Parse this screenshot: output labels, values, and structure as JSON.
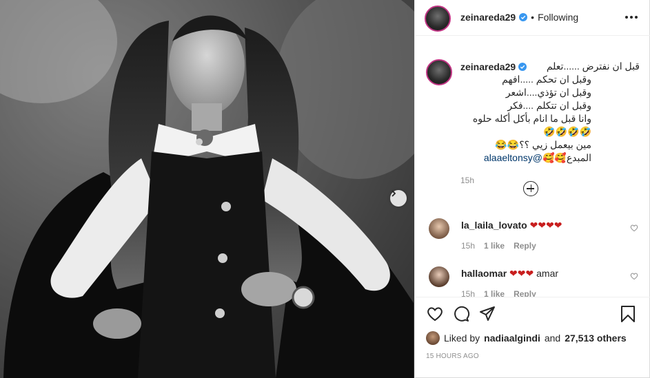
{
  "post": {
    "photo_alt": "Black and white photo of woman in cape and vest",
    "has_next": true
  },
  "header": {
    "username": "zeinareda29",
    "separator": "•",
    "follow_state": "Following"
  },
  "caption": {
    "username": "zeinareda29",
    "lines": [
      "قبل ان نفترض ......تعلم",
      "وقبل ان تحكم .....افهم",
      "وقبل ان تؤذي....اشعر",
      "وقبل ان تتكلم ....فكر",
      "وانا قبل ما انام بأكل أكله حلوه 🤣🤣🤣🤣",
      "مين بيعمل زيي ؟؟😂😂"
    ],
    "mention_prefix": "المبدع🥰🥰",
    "mention": "@alaaeltonsy",
    "time": "15h"
  },
  "comments": [
    {
      "username": "la_laila_lovato",
      "text": "",
      "hearts": "❤❤❤❤",
      "time": "15h",
      "likes": "1 like",
      "reply": "Reply"
    },
    {
      "username": "hallaomar",
      "text": "amar",
      "hearts": "❤❤❤",
      "time": "15h",
      "likes": "1 like",
      "reply": "Reply"
    }
  ],
  "footer": {
    "liked_by_prefix": "Liked by",
    "liked_by_user": "nadiaalgindi",
    "and": "and",
    "others": "27,513 others",
    "ago": "15 HOURS AGO"
  },
  "colors": {
    "text": "#262626",
    "muted": "#8e8e8e",
    "link": "#00376b",
    "verified": "#3897f0",
    "heart": "#c81e1e",
    "border": "#efefef"
  }
}
